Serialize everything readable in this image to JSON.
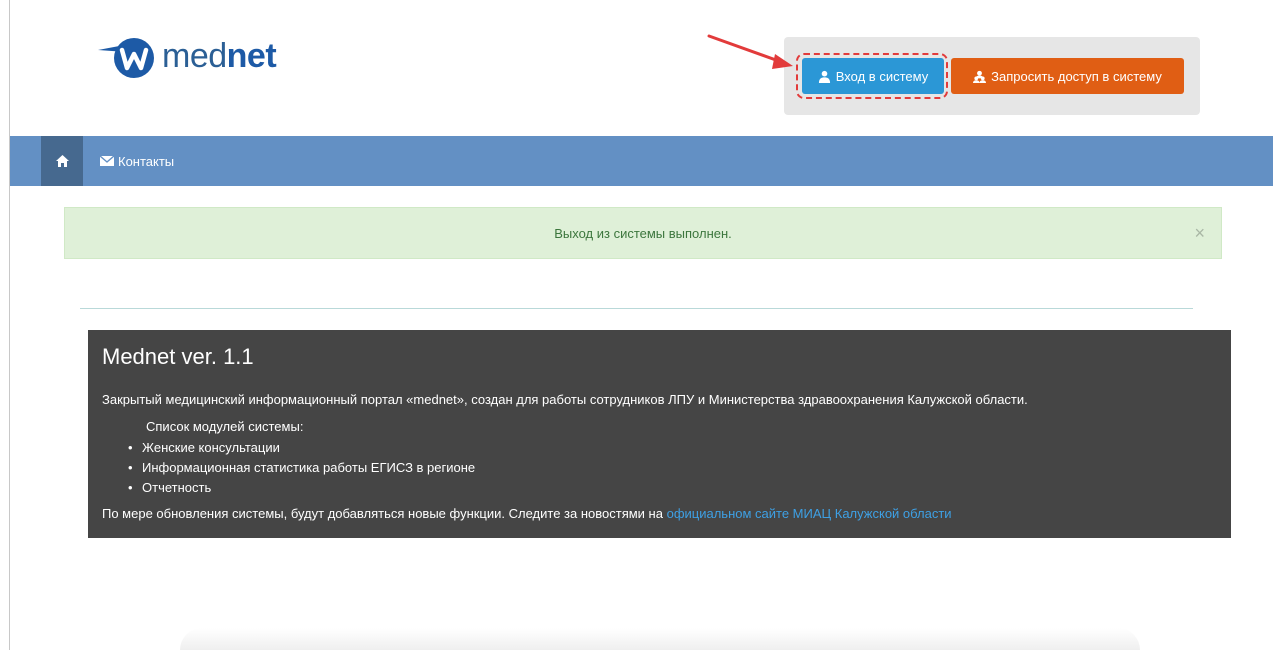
{
  "header": {
    "logo": {
      "text_light": "med",
      "text_bold": "net",
      "icon": "mednet-logo-icon"
    },
    "auth": {
      "login_label": "Вход в систему",
      "login_icon": "user-icon",
      "request_label": "Запросить доступ в систему",
      "request_icon": "users-icon"
    },
    "colors": {
      "login_button": "#2b97d6",
      "request_button": "#e05e14",
      "highlight": "#e23b3b"
    }
  },
  "navbar": {
    "home_icon": "home-icon",
    "contacts_icon": "envelope-icon",
    "contacts_label": "Контакты",
    "color": "#6390c4"
  },
  "alert": {
    "message": "Выход из системы выполнен.",
    "close_label": "×"
  },
  "info": {
    "title": "Mednet ver. 1.1",
    "description": "Закрытый медицинский информационный портал «mednet», создан для работы сотрудников ЛПУ и Министерства здравоохранения Калужской области.",
    "modules_heading": "Список модулей системы:",
    "modules": [
      "Женские консультации",
      "Информационная статистика работы ЕГИСЗ в регионе",
      "Отчетность"
    ],
    "footer_text": "По мере обновления системы, будут добавляться новые функции. Следите за новостями на",
    "footer_link": "официальном сайте МИАЦ Калужской области"
  }
}
